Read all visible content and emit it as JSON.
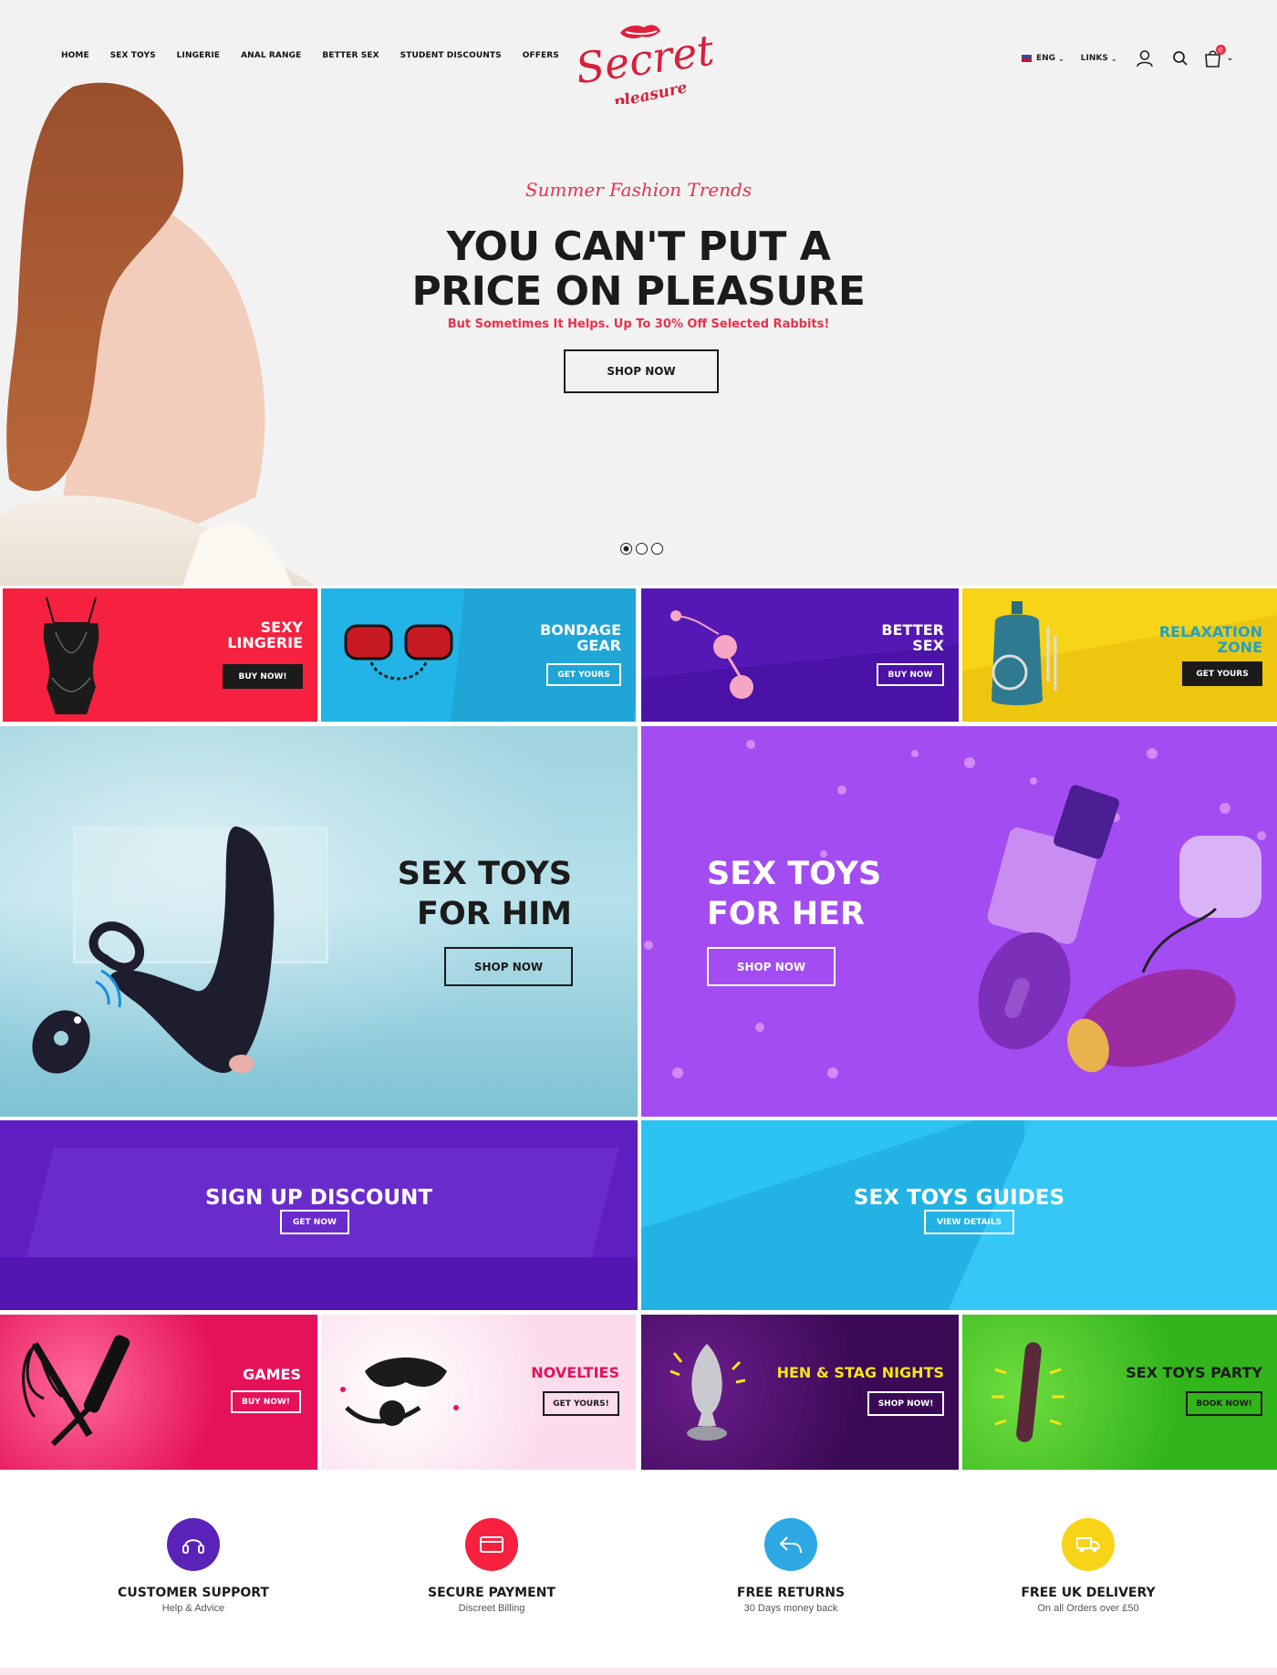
{
  "nav": {
    "items": [
      "HOME",
      "SEX TOYS",
      "LINGERIE",
      "ANAL RANGE",
      "BETTER SEX",
      "STUDENT DISCOUNTS",
      "OFFERS"
    ]
  },
  "brand": {
    "name": "Secret",
    "sub": "pleasure"
  },
  "utility": {
    "language": "ENG",
    "links": "LINKS",
    "cart_count": "0"
  },
  "hero": {
    "tagline": "Summer Fashion Trends",
    "headline_line1": "YOU CAN'T PUT A",
    "headline_line2": "PRICE ON PLEASURE",
    "subline": "But Sometimes It Helps. Up To 30% Off Selected Rabbits!",
    "button": "SHOP NOW",
    "slides_total": 3,
    "active_slide": 1
  },
  "category_row1": [
    {
      "line1": "SEXY",
      "line2": "LINGERIE",
      "button": "BUY NOW!",
      "bg": "#f5213f"
    },
    {
      "line1": "BONDAGE",
      "line2": "GEAR",
      "button": "GET YOURS",
      "bg": "#22b4e6"
    },
    {
      "line1": "BETTER",
      "line2": "SEX",
      "button": "BUY NOW",
      "bg": "#5418b5"
    },
    {
      "line1": "RELAXATION",
      "line2": "ZONE",
      "button": "GET YOURS",
      "bg": "#f7d418"
    }
  ],
  "promo_him": {
    "line1": "SEX TOYS",
    "line2": "FOR HIM",
    "button": "SHOP NOW"
  },
  "promo_her": {
    "line1": "SEX TOYS",
    "line2": "FOR HER",
    "button": "SHOP NOW"
  },
  "wide_left": {
    "title": "SIGN UP DISCOUNT",
    "button": "GET NOW"
  },
  "wide_right": {
    "title": "SEX TOYS GUIDES",
    "button": "VIEW DETAILS"
  },
  "category_row2": [
    {
      "title": "GAMES",
      "button": "BUY NOW!",
      "bg": "#e5125a"
    },
    {
      "title": "NOVELTIES",
      "button": "GET YOURS!",
      "bg": "#fbdcec"
    },
    {
      "title": "HEN & STAG NIGHTS",
      "button": "SHOP NOW!",
      "bg": "#3a0a54"
    },
    {
      "title": "SEX TOYS PARTY",
      "button": "BOOK NOW!",
      "bg": "#32b41c"
    }
  ],
  "features": [
    {
      "title": "CUSTOMER SUPPORT",
      "sub": "Help & Advice",
      "color": "#5a22b8",
      "icon": "headset-icon"
    },
    {
      "title": "SECURE PAYMENT",
      "sub": "Discreet Billing",
      "color": "#f5213f",
      "icon": "credit-card-icon"
    },
    {
      "title": "FREE RETURNS",
      "sub": "30 Days money back",
      "color": "#2ea8e4",
      "icon": "return-arrow-icon"
    },
    {
      "title": "FREE UK DELIVERY",
      "sub": "On all Orders over £50",
      "color": "#f7d418",
      "icon": "delivery-truck-icon"
    }
  ]
}
